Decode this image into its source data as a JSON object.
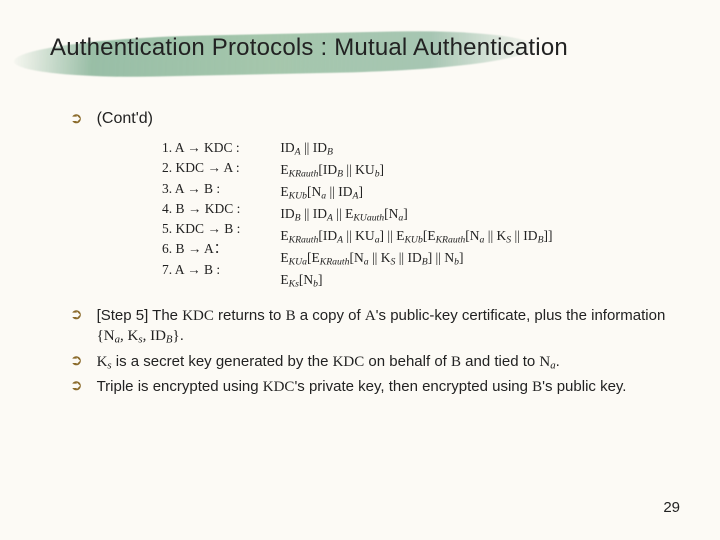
{
  "title": "Authentication Protocols : Mutual Authentication",
  "contd": "(Cont'd)",
  "bullet_glyph": "➲",
  "steps_left": [
    "1. A → KDC :",
    "2. KDC → A :",
    "3. A → B :",
    "4. B → KDC :",
    "5. KDC → B :",
    "6. B → A：",
    "7. A → B :"
  ],
  "steps_right": [
    "ID<sub>A</sub> || ID<sub>B</sub>",
    "E<sub>KRauth</sub>[ID<sub>B</sub> || KU<sub>b</sub>]",
    "E<sub>KUb</sub>[N<sub>a</sub> || ID<sub>A</sub>]",
    "ID<sub>B</sub> || ID<sub>A</sub> || E<sub>KUauth</sub>[N<sub>a</sub>]",
    "E<sub>KRauth</sub>[ID<sub>A</sub> || KU<sub>a</sub>] || E<sub>KUb</sub>[E<sub>KRauth</sub>[N<sub>a</sub> || K<sub>S</sub> || ID<sub>B</sub>]]",
    "E<sub>KUa</sub>[E<sub>KRauth</sub>[N<sub>a</sub> || K<sub>S</sub> || ID<sub>B</sub>] || N<sub>b</sub>]",
    "E<sub>Ks</sub>[N<sub>b</sub>]"
  ],
  "notes": [
    "[Step 5] The <span class='tnr'>KDC</span> returns to <span class='tnr'>B</span> a copy of <span class='tnr'>A</span>'s public-key certificate, plus the information <span class='tnr'>{N<sub>a</sub>, K<sub>s</sub>, ID<sub>B</sub>}</span>.",
    "<span class='tnr'>K<sub>s</sub></span> is a secret key generated by the <span class='tnr'>KDC</span> on behalf of <span class='tnr'>B</span> and tied to <span class='tnr'>N<sub>a</sub></span>.",
    "Triple is encrypted using <span class='tnr'>KDC</span>'s private key, then encrypted using <span class='tnr'>B</span>'s public key."
  ],
  "page_number": "29"
}
